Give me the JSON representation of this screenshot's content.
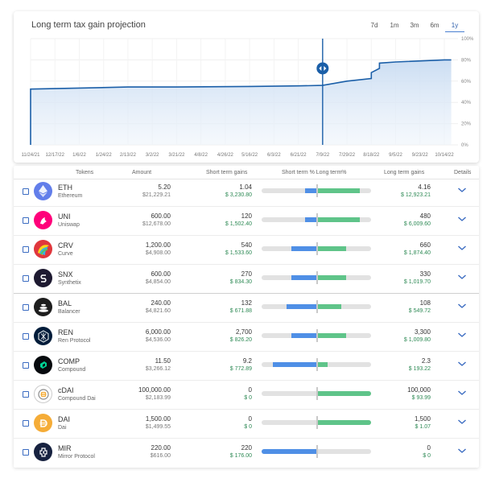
{
  "chart": {
    "title": "Long term tax gain projection",
    "ranges": [
      "7d",
      "1m",
      "3m",
      "6m",
      "1y"
    ],
    "active_range": "1y"
  },
  "chart_data": {
    "type": "area",
    "x_ticks": [
      "11/24/21",
      "12/17/22",
      "1/6/22",
      "1/24/22",
      "2/13/22",
      "3/2/22",
      "3/21/22",
      "4/8/22",
      "4/26/22",
      "5/16/22",
      "6/3/22",
      "6/21/22",
      "7/9/22",
      "7/29/22",
      "8/18/22",
      "9/5/22",
      "9/23/22",
      "10/14/22"
    ],
    "y_ticks": [
      "0%",
      "20%",
      "40%",
      "60%",
      "80%",
      "100%"
    ],
    "ylim": [
      0,
      100
    ],
    "grid": true,
    "marker_at": "7/9/22",
    "series": [
      {
        "points": [
          [
            "11/24/21",
            0
          ],
          [
            "11/24/21",
            52.5
          ],
          [
            "1/6/22",
            53.5
          ],
          [
            "2/13/22",
            54.5
          ],
          [
            "3/21/22",
            54.5
          ],
          [
            "5/16/22",
            55
          ],
          [
            "6/21/22",
            55.5
          ],
          [
            "7/9/22",
            56
          ],
          [
            "7/29/22",
            60
          ],
          [
            "8/18/22",
            62.5
          ],
          [
            "8/18/22",
            68
          ],
          [
            "8/24/22",
            72
          ],
          [
            "8/24/22",
            77
          ],
          [
            "9/5/22",
            78
          ],
          [
            "10/14/22",
            80
          ],
          [
            "10/20/22",
            80
          ]
        ]
      }
    ]
  },
  "table": {
    "headers": {
      "tokens": "Tokens",
      "amount": "Amount",
      "short": "Short term gains",
      "pct": "Short term % Long term%",
      "long": "Long term gains",
      "details": "Details"
    },
    "rows": [
      {
        "symbol": "ETH",
        "name": "Ethereum",
        "amount": "5.20",
        "amount_usd": "$21,229.21",
        "short": "1.04",
        "short_usd": "$ 3,230.80",
        "long": "4.16",
        "long_usd": "$ 12,923.21",
        "short_pct": 20,
        "long_pct": 80,
        "icon": "ethereum-icon",
        "color": "#627eea"
      },
      {
        "symbol": "UNI",
        "name": "Uniswap",
        "amount": "600.00",
        "amount_usd": "$12,678.00",
        "short": "120",
        "short_usd": "$ 1,502.40",
        "long": "480",
        "long_usd": "$ 6,009.60",
        "short_pct": 20,
        "long_pct": 80,
        "icon": "uniswap-icon",
        "color": "#ff007a"
      },
      {
        "symbol": "CRV",
        "name": "Curve",
        "amount": "1,200.00",
        "amount_usd": "$4,908.00",
        "short": "540",
        "short_usd": "$ 1,533.60",
        "long": "660",
        "long_usd": "$ 1,874.40",
        "short_pct": 45,
        "long_pct": 55,
        "icon": "curve-icon",
        "color": "#e0373d"
      },
      {
        "symbol": "SNX",
        "name": "Synthetix",
        "amount": "600.00",
        "amount_usd": "$4,854.00",
        "short": "270",
        "short_usd": "$ 834.30",
        "long": "330",
        "long_usd": "$ 1,019.70",
        "short_pct": 45,
        "long_pct": 55,
        "icon": "synthetix-icon",
        "color": "#1e1a31"
      },
      {
        "symbol": "BAL",
        "name": "Balancer",
        "amount": "240.00",
        "amount_usd": "$4,821.60",
        "short": "132",
        "short_usd": "$ 671.88",
        "long": "108",
        "long_usd": "$ 549.72",
        "short_pct": 55,
        "long_pct": 45,
        "icon": "balancer-icon",
        "color": "#1e1e1e"
      },
      {
        "symbol": "REN",
        "name": "Ren Protocol",
        "amount": "6,000.00",
        "amount_usd": "$4,536.00",
        "short": "2,700",
        "short_usd": "$ 826.20",
        "long": "3,300",
        "long_usd": "$ 1,009.80",
        "short_pct": 45,
        "long_pct": 55,
        "icon": "ren-icon",
        "color": "#001c3a"
      },
      {
        "symbol": "COMP",
        "name": "Compound",
        "amount": "11.50",
        "amount_usd": "$3,266.12",
        "short": "9.2",
        "short_usd": "$ 772.89",
        "long": "2.3",
        "long_usd": "$ 193.22",
        "short_pct": 80,
        "long_pct": 20,
        "icon": "compound-icon",
        "color": "#070a0e"
      },
      {
        "symbol": "cDAI",
        "name": "Compound Dai",
        "amount": "100,000.00",
        "amount_usd": "$2,183.99",
        "short": "0",
        "short_usd": "$ 0",
        "long": "100,000",
        "long_usd": "$ 93.99",
        "short_pct": 0,
        "long_pct": 100,
        "icon": "cdai-icon",
        "color": "#ffffff"
      },
      {
        "symbol": "DAI",
        "name": "Dai",
        "amount": "1,500.00",
        "amount_usd": "$1,499.55",
        "short": "0",
        "short_usd": "$ 0",
        "long": "1,500",
        "long_usd": "$ 1.07",
        "short_pct": 0,
        "long_pct": 100,
        "icon": "dai-icon",
        "color": "#f5ac37"
      },
      {
        "symbol": "MIR",
        "name": "Mirror Protocol",
        "amount": "220.00",
        "amount_usd": "$616.00",
        "short": "220",
        "short_usd": "$ 176.00",
        "long": "0",
        "long_usd": "$ 0",
        "short_pct": 100,
        "long_pct": 0,
        "icon": "mirror-icon",
        "color": "#172240"
      }
    ]
  },
  "colors": {
    "accent": "#1b5fa8",
    "short_bar": "#4f8fe6",
    "long_bar": "#5fc489",
    "gain_text": "#2e8a55"
  }
}
